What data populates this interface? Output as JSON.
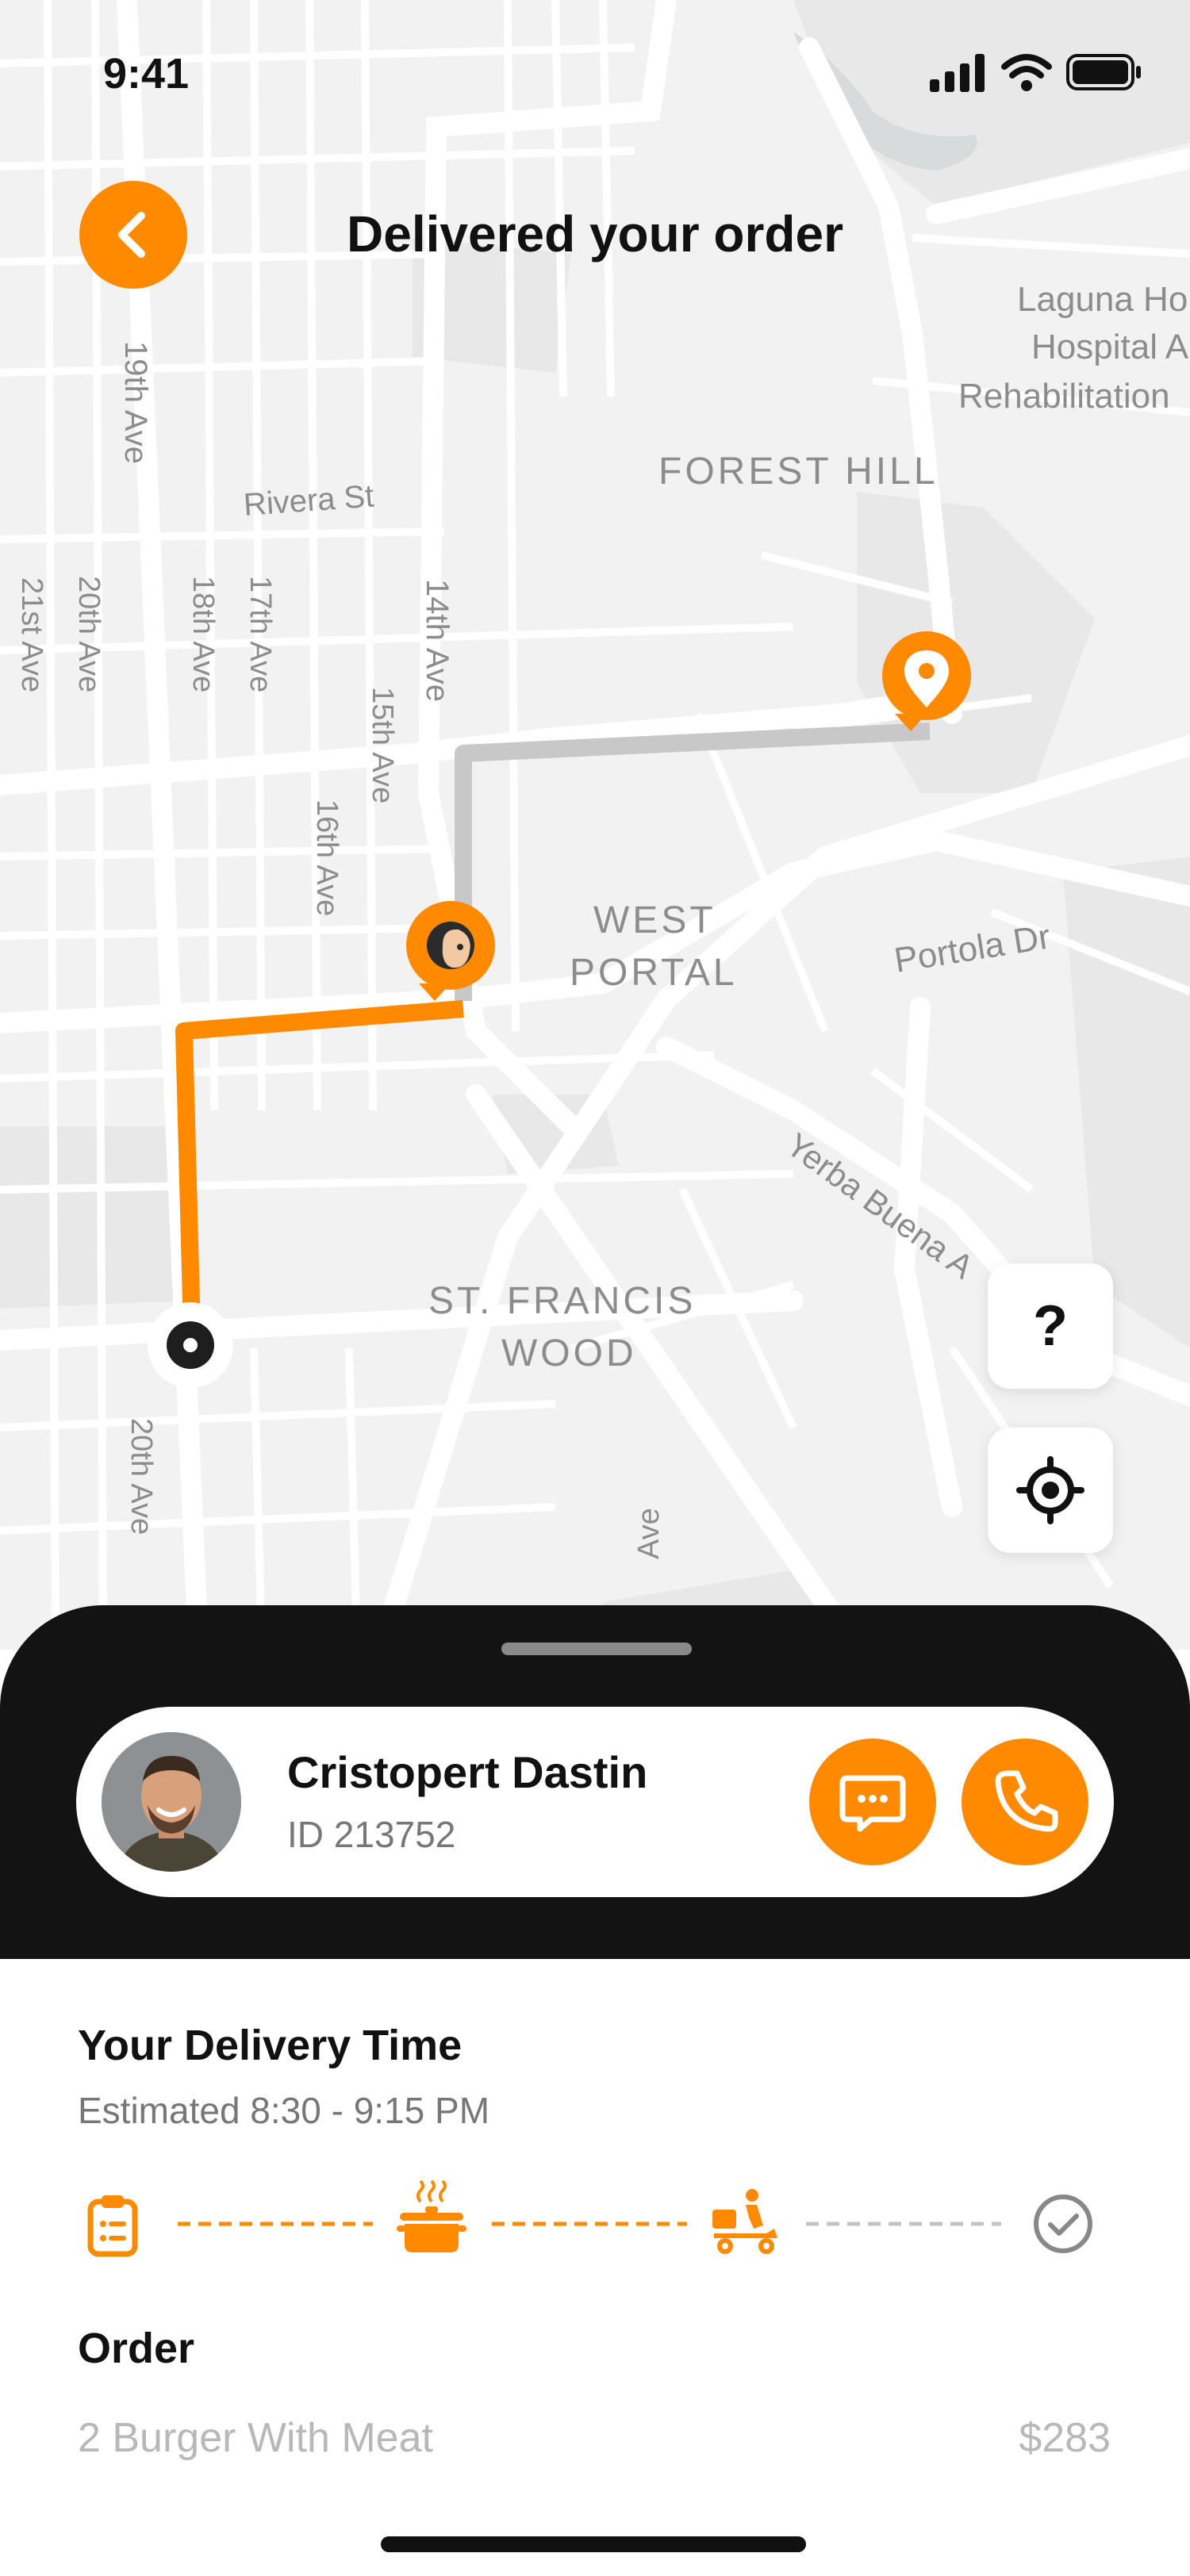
{
  "status_bar": {
    "time": "9:41"
  },
  "header": {
    "title": "Delivered your order"
  },
  "map": {
    "labels": {
      "ave_19th": "19th Ave",
      "rivera": "Rivera St",
      "ave_21st": "21st Ave",
      "ave_20th": "20th Ave",
      "ave_18th": "18th Ave",
      "ave_17th": "17th Ave",
      "ave_14th": "14th Ave",
      "ave_15th": "15th Ave",
      "ave_16th": "16th Ave",
      "forest_hill": "FOREST HILL",
      "laguna1": "Laguna Ho",
      "laguna2": "Hospital A",
      "laguna3": "Rehabilitation",
      "west": "WEST",
      "portal": "PORTAL",
      "portola": "Portola Dr",
      "yerba": "Yerba Buena A",
      "st_francis": "ST. FRANCIS",
      "wood": "WOOD",
      "ave_20th_b": "20th Ave",
      "ave_partial": "Ave"
    },
    "help_label": "?"
  },
  "courier": {
    "name": "Cristopert Dastin",
    "id": "ID 213752"
  },
  "delivery": {
    "title": "Your Delivery Time",
    "estimate": "Estimated 8:30 - 9:15 PM"
  },
  "progress_steps": [
    {
      "icon": "clipboard-icon",
      "state": "done"
    },
    {
      "icon": "cooking-pot-icon",
      "state": "done"
    },
    {
      "icon": "delivery-scooter-icon",
      "state": "active"
    },
    {
      "icon": "check-circle-icon",
      "state": "pending"
    }
  ],
  "order": {
    "title": "Order",
    "item": "2 Burger With Meat",
    "price": "$283"
  },
  "colors": {
    "accent": "#FF8A00",
    "dark_sheet": "#131313",
    "route_inactive": "#c8c8c8"
  }
}
